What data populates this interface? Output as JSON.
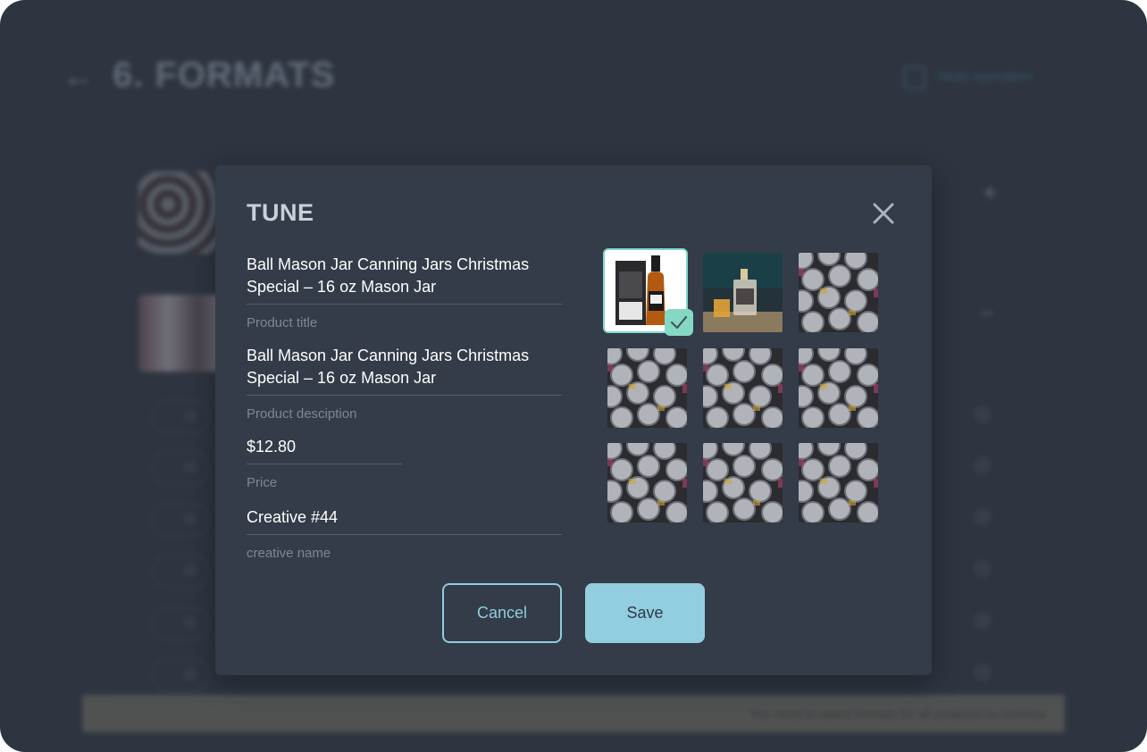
{
  "background": {
    "page_title": "6. FORMATS",
    "back_icon": "arrow-left-icon",
    "action_label": "Multi-operation",
    "banner_text": "You need to select formats for all products to continue"
  },
  "modal": {
    "title": "TUNE",
    "close_icon": "close-icon",
    "fields": {
      "product_title": {
        "value": "Ball Mason Jar Canning Jars Christmas Special – 16 oz Mason Jar",
        "label": "Product title"
      },
      "product_description": {
        "value": "Ball Mason Jar Canning Jars Christmas Special – 16 oz Mason Jar",
        "label": "Product desciption"
      },
      "price": {
        "value": "$12.80",
        "label": "Price"
      },
      "creative_name": {
        "value": "Creative #44",
        "label": "creative name"
      }
    },
    "images": [
      {
        "kind": "whiskey-bottle-box",
        "selected": true
      },
      {
        "kind": "bottle-with-glass",
        "selected": false
      },
      {
        "kind": "cans-pattern",
        "selected": false
      },
      {
        "kind": "cans-pattern",
        "selected": false
      },
      {
        "kind": "cans-pattern",
        "selected": false
      },
      {
        "kind": "cans-pattern",
        "selected": false
      },
      {
        "kind": "cans-pattern",
        "selected": false
      },
      {
        "kind": "cans-pattern",
        "selected": false
      },
      {
        "kind": "cans-pattern",
        "selected": false
      }
    ],
    "buttons": {
      "cancel": "Cancel",
      "save": "Save"
    }
  },
  "colors": {
    "backdrop": "#2e3540",
    "modal_bg": "#333c48",
    "accent_teal": "#85d9c4",
    "save_bg": "#93cde0",
    "cancel_border": "#8fcde0"
  }
}
